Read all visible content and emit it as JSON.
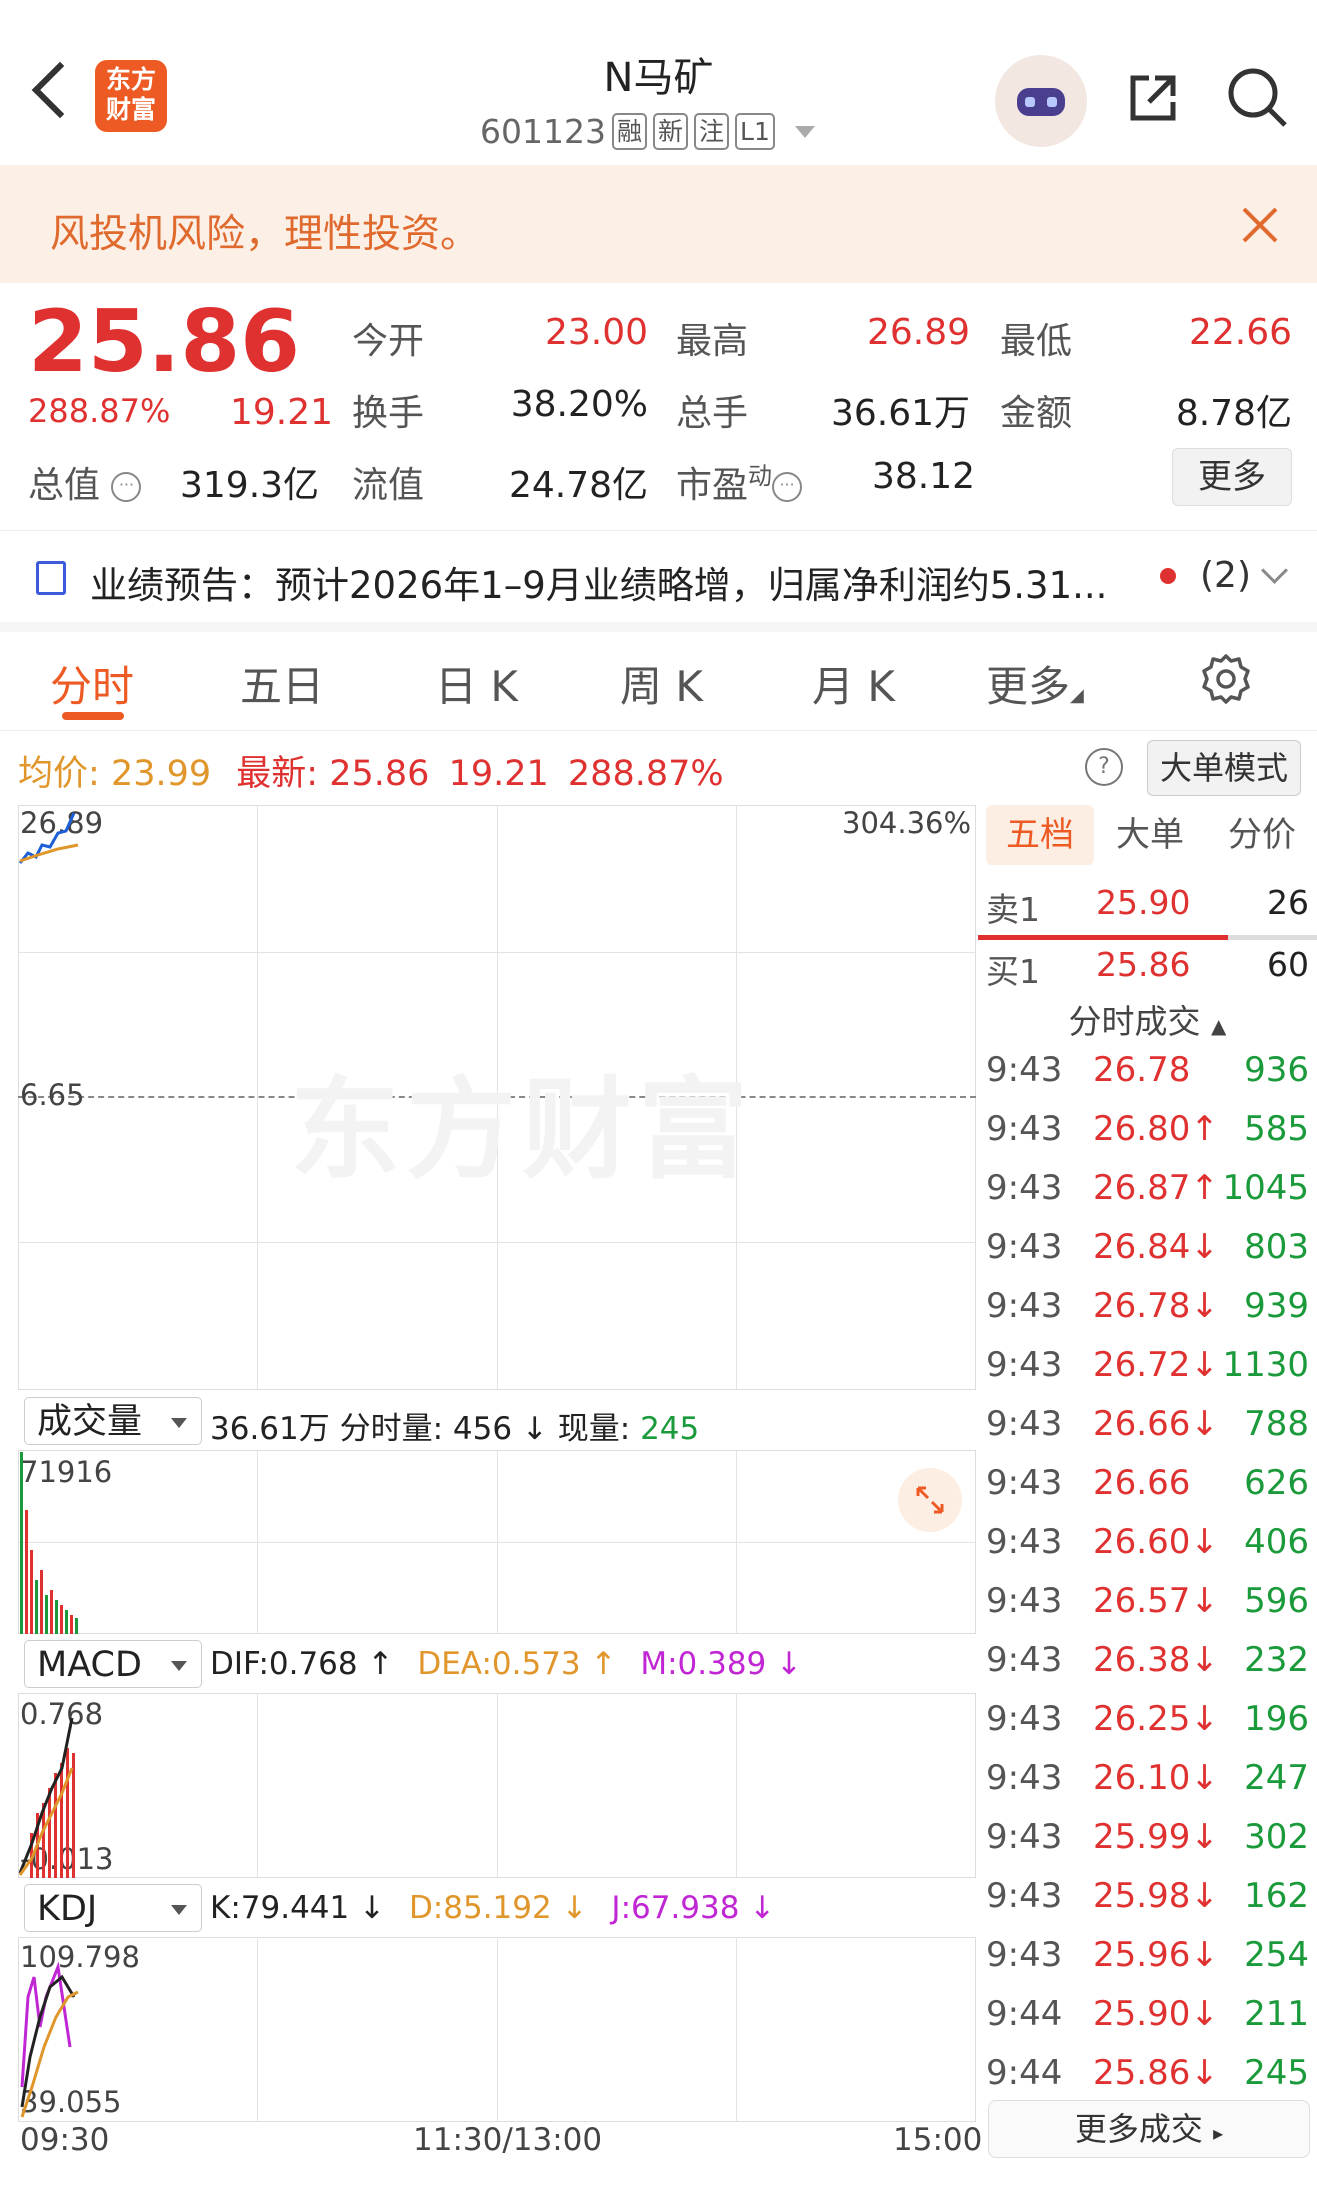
{
  "header": {
    "logo_text_1": "东方",
    "logo_text_2": "财富",
    "stock_name": "N马矿",
    "stock_code": "601123",
    "tags": [
      "融",
      "新",
      "注",
      "L1"
    ]
  },
  "banner": {
    "text": "风投机风险，理性投资。"
  },
  "quote": {
    "price": "25.86",
    "change_pct": "288.87%",
    "change_amt": "19.21",
    "fields": [
      {
        "label": "今开",
        "value": "23.00",
        "color": "#e03131"
      },
      {
        "label": "最高",
        "value": "26.89",
        "color": "#e03131"
      },
      {
        "label": "最低",
        "value": "22.66",
        "color": "#e03131"
      },
      {
        "label": "换手",
        "value": "38.20%",
        "color": "#222222"
      },
      {
        "label": "总手",
        "value": "36.61万",
        "color": "#222222"
      },
      {
        "label": "金额",
        "value": "8.78亿",
        "color": "#222222"
      }
    ],
    "market_cap_label": "总值",
    "market_cap": "319.3亿",
    "float_cap_label": "流值",
    "float_cap": "24.78亿",
    "pe_label": "市盈",
    "pe_sup": "动",
    "pe": "38.12",
    "more_label": "更多"
  },
  "notice": {
    "text": "业绩预告：预计2026年1–9月业绩略增，归属净利润约5.31...",
    "count": "(2)"
  },
  "tabs": [
    {
      "label": "分时",
      "active": true
    },
    {
      "label": "五日",
      "active": false
    },
    {
      "label": "日 K",
      "active": false
    },
    {
      "label": "周 K",
      "active": false
    },
    {
      "label": "月 K",
      "active": false
    },
    {
      "label": "更多",
      "active": false
    }
  ],
  "price_line": {
    "avg_label": "均价:",
    "avg": "23.99",
    "latest_label": "最新:",
    "latest": "25.86",
    "chg": "19.21",
    "pct": "288.87%",
    "big_order_mode": "大单模式"
  },
  "chart": {
    "top_left": "26.89",
    "top_right": "304.36%",
    "mid_label": "6.65",
    "watermark": "东方财富",
    "volume_selector": "成交量",
    "volume_info_1": "36.61万 分时量: 456 ↓ 现量:",
    "volume_info_2": "245",
    "volume_max": "71916",
    "macd_selector": "MACD",
    "macd_dif": "DIF:0.768 ↑",
    "macd_dea": "DEA:0.573 ↑",
    "macd_m": "M:0.389 ↓",
    "macd_top": "0.768",
    "macd_bottom": "-0.013",
    "kdj_selector": "KDJ",
    "kdj_k": "K:79.441 ↓",
    "kdj_d": "D:85.192 ↓",
    "kdj_j": "J:67.938 ↓",
    "kdj_top": "109.798",
    "kdj_bottom": "39.055",
    "time_start": "09:30",
    "time_mid": "11:30/13:00",
    "time_end": "15:00"
  },
  "order_book": {
    "tabs": [
      "五档",
      "大单",
      "分价"
    ],
    "sell_label": "卖1",
    "sell_price": "25.90",
    "sell_vol": "26",
    "buy_label": "买1",
    "buy_price": "25.86",
    "buy_vol": "60",
    "trades_title": "分时成交",
    "more_trades": "更多成交"
  },
  "trades": [
    {
      "t": "9:43",
      "p": "26.78",
      "v": "936"
    },
    {
      "t": "9:43",
      "p": "26.80↑",
      "v": "585"
    },
    {
      "t": "9:43",
      "p": "26.87↑",
      "v": "1045"
    },
    {
      "t": "9:43",
      "p": "26.84↓",
      "v": "803"
    },
    {
      "t": "9:43",
      "p": "26.78↓",
      "v": "939"
    },
    {
      "t": "9:43",
      "p": "26.72↓",
      "v": "1130"
    },
    {
      "t": "9:43",
      "p": "26.66↓",
      "v": "788"
    },
    {
      "t": "9:43",
      "p": "26.66",
      "v": "626"
    },
    {
      "t": "9:43",
      "p": "26.60↓",
      "v": "406"
    },
    {
      "t": "9:43",
      "p": "26.57↓",
      "v": "596"
    },
    {
      "t": "9:43",
      "p": "26.38↓",
      "v": "232"
    },
    {
      "t": "9:43",
      "p": "26.25↓",
      "v": "196"
    },
    {
      "t": "9:43",
      "p": "26.10↓",
      "v": "247"
    },
    {
      "t": "9:43",
      "p": "25.99↓",
      "v": "302"
    },
    {
      "t": "9:43",
      "p": "25.98↓",
      "v": "162"
    },
    {
      "t": "9:43",
      "p": "25.96↓",
      "v": "254"
    },
    {
      "t": "9:44",
      "p": "25.90↓",
      "v": "211"
    },
    {
      "t": "9:44",
      "p": "25.86↓",
      "v": "245"
    }
  ]
}
